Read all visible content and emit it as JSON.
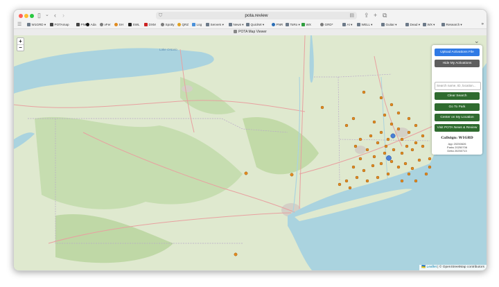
{
  "browser": {
    "url": "pota.review",
    "tab_title": "POTA Map Viewer",
    "bookmarks": [
      {
        "label": "W1GRD ▾",
        "icon": "folder-icon",
        "color": "#6c7a89"
      },
      {
        "label": "POTAmap",
        "icon": "tower-icon",
        "color": "#444444"
      },
      {
        "label": "PNR",
        "icon": "tower-icon",
        "color": "#444444"
      },
      {
        "label": "Ada",
        "icon": "circle-icon",
        "color": "#111111"
      },
      {
        "label": "vFer",
        "icon": "globe-icon",
        "color": "#7a7a7a"
      },
      {
        "label": "SH",
        "icon": "circle-icon",
        "color": "#e08a1e"
      },
      {
        "label": "SWL",
        "icon": "square-icon",
        "color": "#222222"
      },
      {
        "label": "DXM",
        "icon": "flag-icon",
        "color": "#cc2222"
      },
      {
        "label": "Spotty",
        "icon": "globe-icon",
        "color": "#7a7a7a"
      },
      {
        "label": "QRZ",
        "icon": "circle-icon",
        "color": "#e0a020"
      },
      {
        "label": "Log",
        "icon": "cloud-icon",
        "color": "#4a90d9"
      },
      {
        "label": "Servers ▾",
        "icon": "folder-icon",
        "color": "#6c7a89"
      },
      {
        "label": "News ▾",
        "icon": "folder-icon",
        "color": "#6c7a89"
      },
      {
        "label": "QuickW ▾",
        "icon": "folder-icon",
        "color": "#6c7a89"
      },
      {
        "label": "PNR",
        "icon": "globe-icon",
        "color": "#2a6db5"
      },
      {
        "label": "ToRo ▾",
        "icon": "folder-icon",
        "color": "#6c7a89"
      },
      {
        "label": "WX",
        "icon": "square-icon",
        "color": "#2e9e3e"
      },
      {
        "label": "GRD*",
        "icon": "globe-icon",
        "color": "#7a7a7a"
      },
      {
        "label": "AI ▾",
        "icon": "folder-icon",
        "color": "#6c7a89"
      },
      {
        "label": "WELL ▾",
        "icon": "folder-icon",
        "color": "#6c7a89"
      },
      {
        "label": "Guitar ▾",
        "icon": "folder-icon",
        "color": "#6c7a89"
      },
      {
        "label": "Dead ▾",
        "icon": "folder-icon",
        "color": "#6c7a89"
      },
      {
        "label": "WX ▾",
        "icon": "folder-icon",
        "color": "#6c7a89"
      },
      {
        "label": "Research ▾",
        "icon": "folder-icon",
        "color": "#6c7a89"
      }
    ],
    "overflow_label": "»"
  },
  "map": {
    "zoom_in": "+",
    "zoom_out": "−",
    "place_label": "Lake Ontario",
    "attribution_leaflet": "🇺🇦 Leaflet",
    "attribution_rest": " | © OpenStreetMap contributors",
    "colors": {
      "water": "#aad3df",
      "land": "#dcead0",
      "forest": "#b9d6a0",
      "urban": "#d3d0c8",
      "marker": "#e38b1f",
      "marker_selected": "#4a7fd6"
    }
  },
  "panel": {
    "collapse_icon": "⌄",
    "buttons": [
      {
        "label": "Upload Activations File",
        "color": "#2f7ae5"
      },
      {
        "label": "Hide My Activations",
        "color": "#5e5e5e"
      }
    ],
    "search_placeholder": "Search name, ID, location...",
    "actions": [
      {
        "label": "Clear Search",
        "color": "#2f6b2f"
      },
      {
        "label": "Go To Park",
        "color": "#2f6b2f"
      },
      {
        "label": "Center on My Location",
        "color": "#2f6b2f"
      },
      {
        "label": "Visit POTA News & Review",
        "color": "#2f6b2f"
      }
    ],
    "callsign": "Callsign: W1GRD",
    "stats": [
      "App 20250626",
      "Parks 20250706",
      "Delta 20250713"
    ]
  }
}
